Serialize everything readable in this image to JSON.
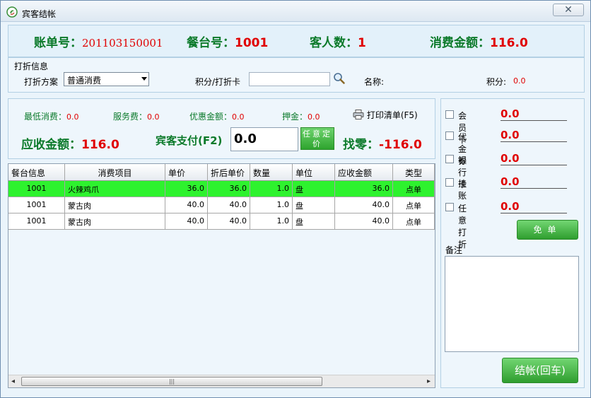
{
  "window": {
    "title": "宾客结帐",
    "close_label": "✕"
  },
  "header": {
    "bill_no_label": "账单号：",
    "bill_no": "201103150001",
    "table_no_label": "餐台号：",
    "table_no": "1001",
    "guests_label": "客人数：",
    "guests": "1",
    "consume_label": "消费金额：",
    "consume": "116.0"
  },
  "discount": {
    "section_title": "打折信息",
    "scheme_label": "打折方案",
    "scheme_value": "普通消费",
    "card_label": "积分/打折卡",
    "card_value": "",
    "name_label": "名称:",
    "name_value": "",
    "points_label": "积分:",
    "points_value": "0.0"
  },
  "summary": {
    "min_label": "最低消费：",
    "min_value": "0.0",
    "service_label": "服务费：",
    "service_value": "0.0",
    "favor_label": "优惠金额：",
    "favor_value": "0.0",
    "deposit_label": "押金：",
    "deposit_value": "0.0",
    "print_label": "打印清单(F5)",
    "receivable_label": "应收金额：",
    "receivable_value": "116.0",
    "pay_label": "宾客支付(F2)",
    "pay_value": "0.0",
    "free_price_label": "任意定价",
    "change_label": "找零：",
    "change_value": "-116.0"
  },
  "grid": {
    "columns": [
      "餐台信息",
      "消费项目",
      "单价",
      "折后单价",
      "数量",
      "单位",
      "应收金额",
      "类型"
    ],
    "rows": [
      [
        "1001",
        "火辣鸡爪",
        "36.0",
        "36.0",
        "1.0",
        "盘",
        "36.0",
        "点单"
      ],
      [
        "1001",
        "蒙古肉",
        "40.0",
        "40.0",
        "1.0",
        "盘",
        "40.0",
        "点单"
      ],
      [
        "1001",
        "蒙古肉",
        "40.0",
        "40.0",
        "1.0",
        "盘",
        "40.0",
        "点单"
      ]
    ],
    "scroll_grip": "|||"
  },
  "payments": {
    "member_card_label": "会员卡",
    "member_card_value": "0.0",
    "voucher_label": "代金券",
    "voucher_value": "0.0",
    "bank_card_label": "银行卡",
    "bank_card_value": "0.0",
    "credit_label": "挂 账",
    "credit_value": "0.0",
    "any_discount_label": "任意打折",
    "any_discount_value": "0.0",
    "free_bill_label": "免单",
    "remark_label": "备注",
    "checkout_label": "结帐(回车)"
  },
  "colors": {
    "accent_green": "#2ea42e",
    "value_red": "#e00000",
    "label_green": "#0b7a2a",
    "selected_row": "#2ef22e"
  }
}
